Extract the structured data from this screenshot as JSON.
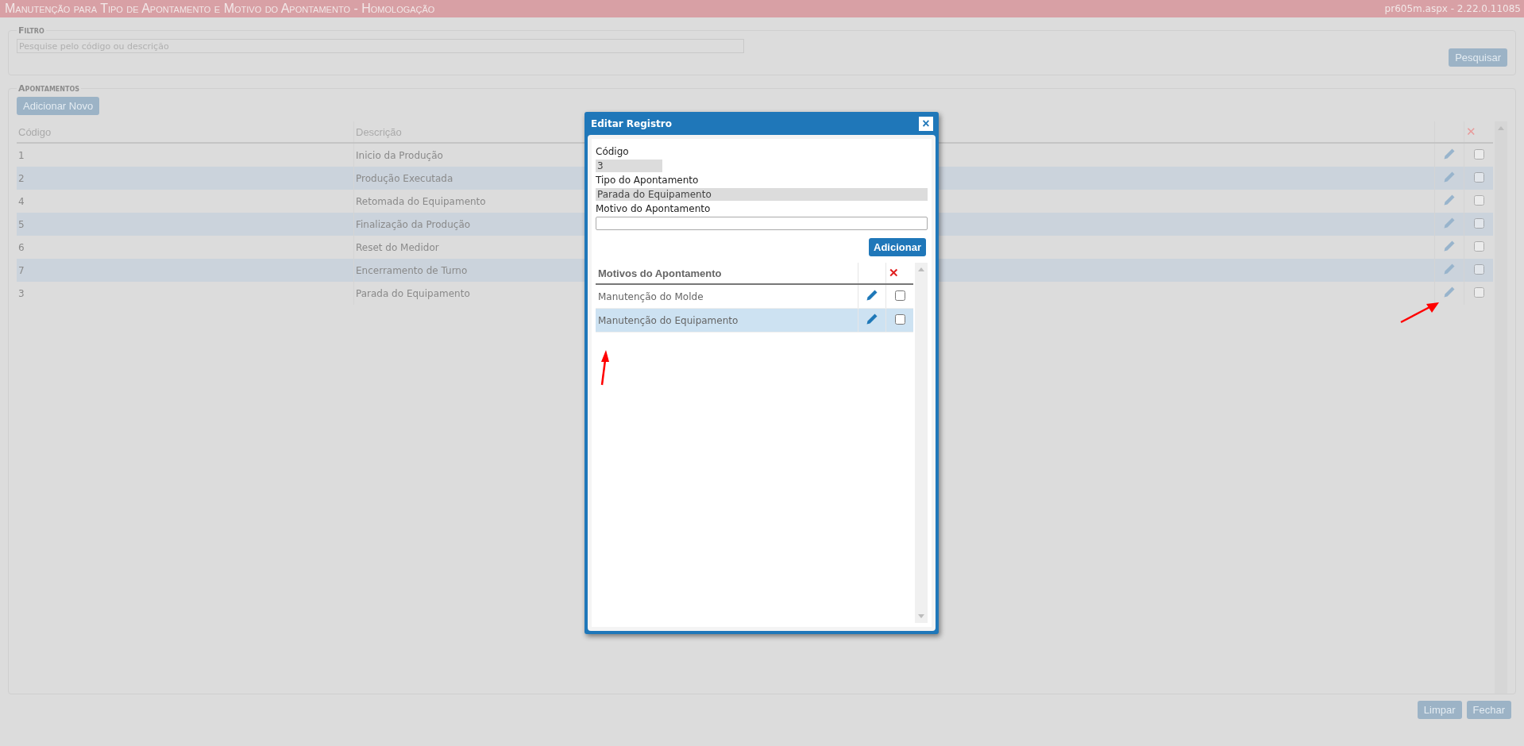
{
  "header": {
    "title": "Manutenção para Tipo de Apontamento e Motivo do Apontamento  - Homologação",
    "version": "pr605m.aspx - 2.22.0.11085"
  },
  "filter": {
    "legend": "Filtro",
    "search": {
      "placeholder": "Pesquise pelo código ou descrição"
    },
    "button": "Pesquisar"
  },
  "records": {
    "legend": "Apontamentos",
    "add_button": "Adicionar Novo",
    "columns": [
      "Código",
      "Descrição"
    ],
    "delete_header": "✕",
    "rows": [
      {
        "code": "1",
        "description": "Inicio da Produção",
        "checked": false
      },
      {
        "code": "2",
        "description": "Produção Executada",
        "checked": false
      },
      {
        "code": "4",
        "description": "Retomada do Equipamento",
        "checked": false
      },
      {
        "code": "5",
        "description": "Finalização da Produção",
        "checked": false
      },
      {
        "code": "6",
        "description": "Reset do Medidor",
        "checked": false
      },
      {
        "code": "7",
        "description": "Encerramento de Turno",
        "checked": false
      },
      {
        "code": "3",
        "description": "Parada do Equipamento",
        "checked": false
      }
    ]
  },
  "footer_buttons": [
    "Limpar",
    "Fechar"
  ],
  "dialog": {
    "title": "Editar Registro",
    "close": "×",
    "fields": [
      {
        "label": "Código",
        "value": "3",
        "kind": "readonly-short"
      },
      {
        "label": "Tipo do Apontamento",
        "value": "Parada do Equipamento",
        "kind": "readonly"
      },
      {
        "label": "Motivo do Apontamento",
        "kind": "input"
      }
    ],
    "add_button": "Adicionar",
    "table_header": "Motivos do Apontamento",
    "delete_header": "✕",
    "rows": [
      {
        "text": "Manutenção do Molde",
        "selected": false,
        "checked": false
      },
      {
        "text": "Manutenção do Equipamento",
        "selected": true,
        "checked": false
      }
    ]
  }
}
